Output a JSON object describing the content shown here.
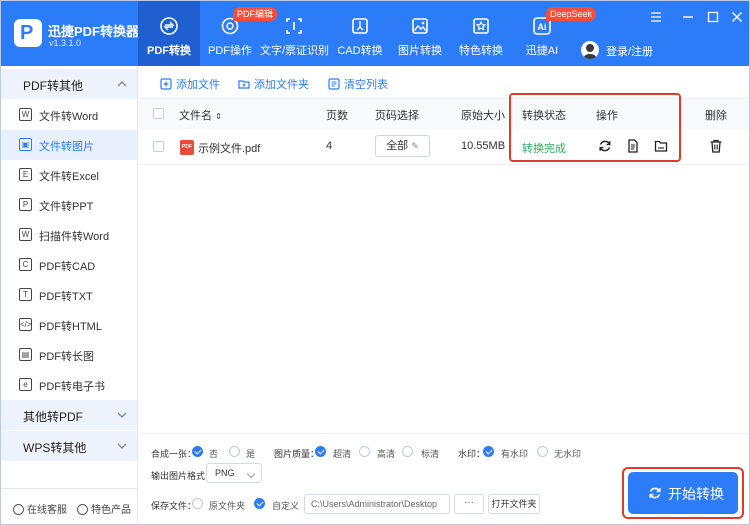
{
  "app": {
    "name": "迅捷PDF转换器",
    "version": "v1.3.1.0"
  },
  "nav": {
    "tabs": [
      {
        "label": "PDF转换",
        "icon": "convert-icon",
        "active": true
      },
      {
        "label": "PDF操作",
        "icon": "pdf-operation-icon",
        "badge": "PDF编辑"
      },
      {
        "label": "文字/票证识别",
        "icon": "ocr-icon"
      },
      {
        "label": "CAD转换",
        "icon": "cad-icon"
      },
      {
        "label": "图片转换",
        "icon": "image-icon"
      },
      {
        "label": "特色转换",
        "icon": "star-icon"
      },
      {
        "label": "迅捷AI",
        "icon": "ai-icon",
        "badge": "DeepSeek"
      }
    ],
    "login": "登录/注册"
  },
  "sidebar": {
    "groups": [
      {
        "title": "PDF转其他",
        "expanded": true
      },
      {
        "title": "其他转PDF",
        "expanded": false
      },
      {
        "title": "WPS转其他",
        "expanded": false
      }
    ],
    "items": [
      {
        "label": "文件转Word",
        "icon": "word-icon",
        "glyph": "W"
      },
      {
        "label": "文件转图片",
        "icon": "image-icon",
        "glyph": "▣",
        "active": true
      },
      {
        "label": "文件转Excel",
        "icon": "excel-icon",
        "glyph": "E"
      },
      {
        "label": "文件转PPT",
        "icon": "ppt-icon",
        "glyph": "P"
      },
      {
        "label": "扫描件转Word",
        "icon": "scan-icon",
        "glyph": "W"
      },
      {
        "label": "PDF转CAD",
        "icon": "cad-icon",
        "glyph": "C"
      },
      {
        "label": "PDF转TXT",
        "icon": "txt-icon",
        "glyph": "T"
      },
      {
        "label": "PDF转HTML",
        "icon": "html-icon",
        "glyph": "</>"
      },
      {
        "label": "PDF转长图",
        "icon": "long-image-icon",
        "glyph": "▤"
      },
      {
        "label": "PDF转电子书",
        "icon": "ebook-icon",
        "glyph": "e"
      }
    ],
    "footer": {
      "service": "在线客服",
      "products": "特色产品"
    }
  },
  "toolbar": {
    "add_file": "添加文件",
    "add_folder": "添加文件夹",
    "clear_list": "清空列表"
  },
  "table": {
    "headers": {
      "name": "文件名",
      "pages": "页数",
      "page_select": "页码选择",
      "size": "原始大小",
      "status": "转换状态",
      "ops": "操作",
      "delete": "删除"
    },
    "rows": [
      {
        "name": "示例文件.pdf",
        "pages": "4",
        "page_select": "全部",
        "size": "10.55MB",
        "status": "转换完成"
      }
    ]
  },
  "settings": {
    "merge_label": "合成一张：",
    "merge_options": [
      "否",
      "是"
    ],
    "merge_selected": "否",
    "quality_label": "图片质量：",
    "quality_options": [
      "超清",
      "高清",
      "标清"
    ],
    "quality_selected": "超清",
    "watermark_label": "水印：",
    "watermark_options": [
      "有水印",
      "无水印"
    ],
    "watermark_selected": "有水印",
    "format_label": "输出图片格式：",
    "format_value": "PNG",
    "save_label": "保存文件：",
    "save_options": [
      "原文件夹",
      "自定义"
    ],
    "save_selected": "自定义",
    "save_path": "C:\\Users\\Administrator\\Desktop",
    "browse_label": "···",
    "open_folder": "打开文件夹"
  },
  "start_button": "开始转换",
  "colors": {
    "primary": "#2d7cf7",
    "success": "#2eab5b",
    "highlight": "#e03a2c",
    "badge": "#ff4b3a"
  }
}
